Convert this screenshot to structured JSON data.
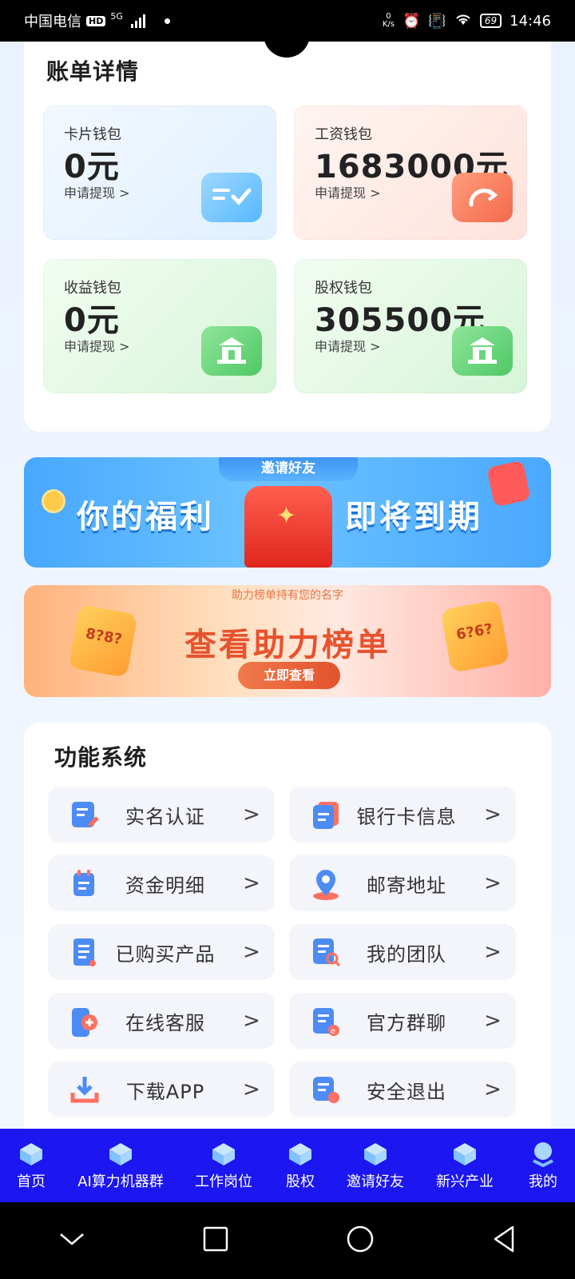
{
  "status_bar": {
    "carrier": "中国电信",
    "hd": "HD",
    "network": "5G",
    "speed_top": "0",
    "speed_unit": "K/s",
    "battery": "69",
    "time": "14:46"
  },
  "bill": {
    "title": "账单详情",
    "wallets": [
      {
        "label": "卡片钱包",
        "amount": "0元",
        "link": "申请提现 >",
        "theme": "blue",
        "icon": "checklist-icon"
      },
      {
        "label": "工资钱包",
        "amount": "1683000元",
        "link": "申请提现 >",
        "theme": "pink",
        "icon": "refresh-ticket-icon"
      },
      {
        "label": "收益钱包",
        "amount": "0元",
        "link": "申请提现 >",
        "theme": "green",
        "icon": "pavilion-icon"
      },
      {
        "label": "股权钱包",
        "amount": "305500元",
        "link": "申请提现 >",
        "theme": "green",
        "icon": "pavilion-icon"
      }
    ]
  },
  "banners": {
    "invite": {
      "tag": "邀请好友",
      "left_text": "你的福利",
      "right_text": "即将到期"
    },
    "rank": {
      "tag": "助力榜单持有您的名字",
      "title": "查看助力榜单",
      "button": "立即查看",
      "card_left": "8?8?",
      "card_right": "6?6?"
    }
  },
  "functions": {
    "title": "功能系统",
    "items": [
      {
        "label": "实名认证",
        "icon": "id-card-edit-icon"
      },
      {
        "label": "银行卡信息",
        "icon": "bank-card-icon"
      },
      {
        "label": "资金明细",
        "icon": "calendar-note-icon"
      },
      {
        "label": "邮寄地址",
        "icon": "location-pin-icon"
      },
      {
        "label": "已购买产品",
        "icon": "document-icon"
      },
      {
        "label": "我的团队",
        "icon": "search-document-icon"
      },
      {
        "label": "在线客服",
        "icon": "phone-support-icon"
      },
      {
        "label": "官方群聊",
        "icon": "group-chat-icon"
      },
      {
        "label": "下载APP",
        "icon": "download-icon"
      },
      {
        "label": "安全退出",
        "icon": "logout-icon"
      }
    ],
    "arrow": ">"
  },
  "bottom_nav": [
    {
      "label": "首页"
    },
    {
      "label": "AI算力机器群"
    },
    {
      "label": "工作岗位"
    },
    {
      "label": "股权"
    },
    {
      "label": "邀请好友"
    },
    {
      "label": "新兴产业"
    },
    {
      "label": "我的"
    }
  ],
  "colors": {
    "nav_bg": "#1c16f0",
    "accent_orange": "#e8522e",
    "invite_blue": "#48a8ff"
  }
}
